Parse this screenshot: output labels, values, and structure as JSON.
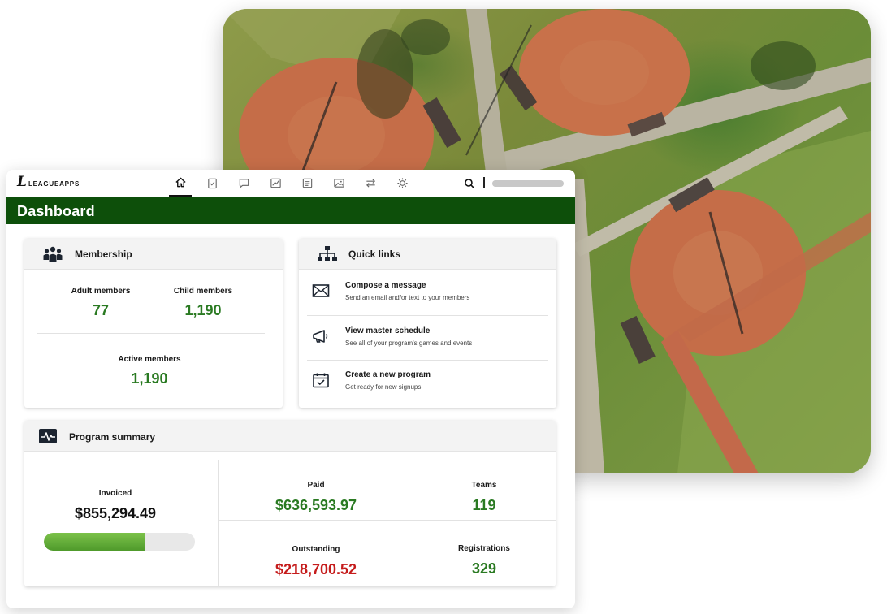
{
  "app": {
    "logo_mark": "L",
    "logo_text": "LEAGUEAPPS"
  },
  "nav": {
    "items": [
      {
        "icon": "home-icon",
        "active": true
      },
      {
        "icon": "clipboard-check-icon",
        "active": false
      },
      {
        "icon": "chat-bubble-icon",
        "active": false
      },
      {
        "icon": "chart-line-icon",
        "active": false
      },
      {
        "icon": "document-list-icon",
        "active": false
      },
      {
        "icon": "image-icon",
        "active": false
      },
      {
        "icon": "swap-arrows-icon",
        "active": false
      },
      {
        "icon": "gear-icon",
        "active": false
      }
    ],
    "search_icon": "search-icon"
  },
  "page": {
    "title": "Dashboard"
  },
  "membership": {
    "title": "Membership",
    "adult_label": "Adult members",
    "adult_value": "77",
    "child_label": "Child members",
    "child_value": "1,190",
    "active_label": "Active members",
    "active_value": "1,190"
  },
  "quick_links": {
    "title": "Quick links",
    "items": [
      {
        "icon": "envelope-icon",
        "title": "Compose a message",
        "subtitle": "Send an email and/or text to your members"
      },
      {
        "icon": "megaphone-icon",
        "title": "View master schedule",
        "subtitle": "See all of your program's games and events"
      },
      {
        "icon": "calendar-check-icon",
        "title": "Create a new program",
        "subtitle": "Get ready for new signups"
      }
    ]
  },
  "program_summary": {
    "title": "Program summary",
    "invoiced_label": "Invoiced",
    "invoiced_value": "$855,294.49",
    "paid_label": "Paid",
    "paid_value": "$636,593.97",
    "outstanding_label": "Outstanding",
    "outstanding_value": "$218,700.52",
    "teams_label": "Teams",
    "teams_value": "119",
    "registrations_label": "Registrations",
    "registrations_value": "329",
    "paid_fraction": 0.67
  },
  "colors": {
    "brand_green": "#0d4f0a",
    "value_green": "#2a7a22",
    "value_red": "#c51c1c"
  }
}
